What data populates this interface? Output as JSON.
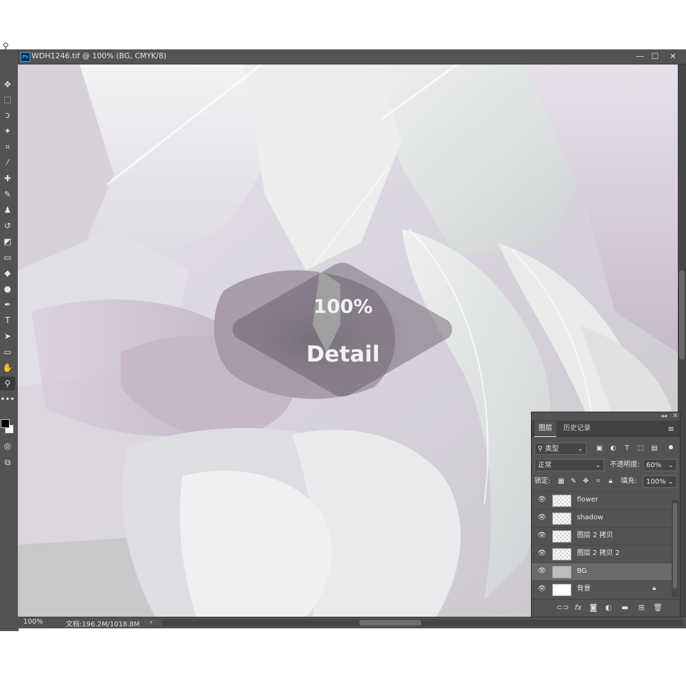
{
  "window": {
    "title": "WDH1246.tif @ 100% (BG, CMYK/8)",
    "app_badge": "Ps",
    "minimize": "—",
    "maximize": "☐",
    "close": "✕"
  },
  "toolbar": {
    "tools": [
      {
        "name": "move-tool-icon",
        "glyph": "✥"
      },
      {
        "name": "marquee-tool-icon",
        "glyph": "⬚"
      },
      {
        "name": "lasso-tool-icon",
        "glyph": "ↄ"
      },
      {
        "name": "magic-wand-tool-icon",
        "glyph": "✦"
      },
      {
        "name": "crop-tool-icon",
        "glyph": "⌗"
      },
      {
        "name": "eyedropper-tool-icon",
        "glyph": "⁄"
      },
      {
        "name": "spot-healing-tool-icon",
        "glyph": "✚"
      },
      {
        "name": "brush-tool-icon",
        "glyph": "✎"
      },
      {
        "name": "clone-stamp-tool-icon",
        "glyph": "♟"
      },
      {
        "name": "history-brush-tool-icon",
        "glyph": "↺"
      },
      {
        "name": "eraser-tool-icon",
        "glyph": "◩"
      },
      {
        "name": "gradient-tool-icon",
        "glyph": "▭"
      },
      {
        "name": "blur-tool-icon",
        "glyph": "◆"
      },
      {
        "name": "dodge-tool-icon",
        "glyph": "●"
      },
      {
        "name": "pen-tool-icon",
        "glyph": "✒"
      },
      {
        "name": "type-tool-icon",
        "glyph": "T"
      },
      {
        "name": "path-selection-tool-icon",
        "glyph": "➤"
      },
      {
        "name": "rectangle-tool-icon",
        "glyph": "▭"
      },
      {
        "name": "hand-tool-icon",
        "glyph": "✋"
      },
      {
        "name": "zoom-tool-icon",
        "glyph": "⚲"
      },
      {
        "name": "more-tools-icon",
        "glyph": "•••"
      }
    ],
    "active_tool": "zoom-tool-icon"
  },
  "overlay": {
    "zoom_text": "100%",
    "detail_text": "Detail"
  },
  "status_bar": {
    "zoom": "100%",
    "doc_info": "文档:196.2M/1018.8M",
    "arrow": "›"
  },
  "layers_panel": {
    "tabs": [
      {
        "label": "图层",
        "active": true
      },
      {
        "label": "历史记录",
        "active": false
      }
    ],
    "filter": {
      "label": "类型"
    },
    "blend_mode": "正常",
    "opacity_label": "不透明度:",
    "opacity_value": "60%",
    "lock_label": "锁定:",
    "fill_label": "填充:",
    "fill_value": "100%",
    "layers": [
      {
        "name": "flower",
        "thumb": "checker",
        "selected": false,
        "locked": false
      },
      {
        "name": "shadow",
        "thumb": "checker",
        "selected": false,
        "locked": false
      },
      {
        "name": "图层 2 拷贝",
        "thumb": "checker",
        "selected": false,
        "locked": false
      },
      {
        "name": "图层 2 拷贝 2",
        "thumb": "checker",
        "selected": false,
        "locked": false
      },
      {
        "name": "BG",
        "thumb": "grey",
        "selected": true,
        "locked": false
      },
      {
        "name": "背景",
        "thumb": "plain",
        "selected": false,
        "locked": true
      }
    ]
  }
}
